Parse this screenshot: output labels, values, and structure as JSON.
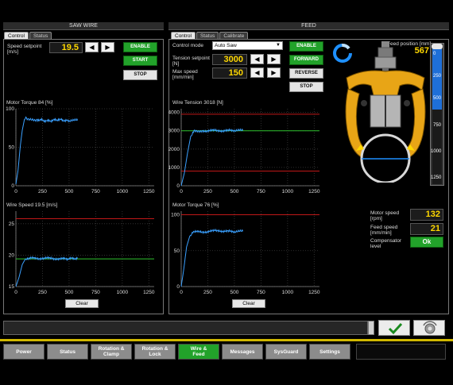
{
  "saw_wire": {
    "title": "SAW WIRE",
    "tabs": [
      "Control",
      "Status"
    ],
    "speed_setpoint": {
      "label": "Speed setpoint",
      "unit": "[m/s]",
      "value": "19.5"
    },
    "buttons": {
      "enable": "ENABLE",
      "start": "START",
      "stop": "STOP"
    },
    "chart_clear_label": "Clear"
  },
  "feed": {
    "title": "FEED",
    "tabs": [
      "Control",
      "Status",
      "Calibrate"
    ],
    "control_mode": {
      "label": "Control mode",
      "value": "Auto Saw"
    },
    "tension_setpoint": {
      "label": "Tension setpoint",
      "unit": "[N]",
      "value": "3000"
    },
    "max_speed": {
      "label": "Max speed",
      "unit": "[mm/min]",
      "value": "150"
    },
    "buttons": {
      "enable": "ENABLE",
      "forward": "FORWARD",
      "reverse": "REVERSE",
      "stop": "STOP"
    },
    "feed_position": {
      "label": "Feed position [mm]",
      "value": "567"
    },
    "gauge_ticks": [
      "0",
      "250",
      "500",
      "750",
      "1000",
      "1250"
    ],
    "motor_speed": {
      "label": "Motor speed",
      "unit": "[rpm]",
      "value": "132"
    },
    "feed_speed": {
      "label": "Feed speed",
      "unit": "[mm/min]",
      "value": "21"
    },
    "compensator": {
      "label": "Compensator",
      "label2": "level",
      "value": "Ok"
    },
    "chart_clear_label": "Clear"
  },
  "nav": [
    {
      "label": "Power",
      "active": false
    },
    {
      "label": "Status",
      "active": false
    },
    {
      "label": "Rotation &\nClamp",
      "active": false
    },
    {
      "label": "Rotation &\nLock",
      "active": false
    },
    {
      "label": "Wire &\nFeed",
      "active": true
    },
    {
      "label": "Messages",
      "active": false
    },
    {
      "label": "SysGuard",
      "active": false
    },
    {
      "label": "Settings",
      "active": false
    }
  ],
  "icons": {
    "confirm": "checkmark-icon",
    "reset": "reset-icon",
    "busy": "busy-spinner-icon"
  },
  "colors": {
    "accent_green": "#22a22a",
    "value_yellow": "#ffd800",
    "trace_blue": "#3aa0ff",
    "limit_red": "#c01818",
    "target_green": "#2fc42f",
    "machine_orange": "#e8a516"
  },
  "chart_data": [
    {
      "type": "line",
      "title": "Motor Torque 84 [%]",
      "xlim": [
        0,
        1300
      ],
      "ylim": [
        0,
        100
      ],
      "xticks": [
        0,
        250,
        500,
        750,
        1000,
        1250
      ],
      "yticks": [
        0,
        50,
        100
      ],
      "series": [
        {
          "points": [
            [
              0,
              2
            ],
            [
              20,
              20
            ],
            [
              40,
              50
            ],
            [
              60,
              72
            ],
            [
              80,
              86
            ],
            [
              100,
              88
            ],
            [
              150,
              85
            ],
            [
              200,
              86
            ],
            [
              300,
              84
            ],
            [
              400,
              86
            ],
            [
              500,
              84
            ],
            [
              580,
              85
            ]
          ]
        }
      ],
      "hlines": []
    },
    {
      "type": "line",
      "title": "Wire Speed 19.5 [m/s]",
      "xlim": [
        0,
        1300
      ],
      "ylim": [
        15,
        27
      ],
      "xticks": [
        0,
        250,
        500,
        750,
        1000,
        1250
      ],
      "yticks": [
        15,
        20,
        25
      ],
      "series": [
        {
          "points": [
            [
              0,
              15
            ],
            [
              30,
              16.5
            ],
            [
              60,
              18.5
            ],
            [
              90,
              19.4
            ],
            [
              150,
              19.5
            ],
            [
              300,
              19.5
            ],
            [
              450,
              19.4
            ],
            [
              580,
              19.5
            ]
          ]
        }
      ],
      "hlines": [
        {
          "y": 25.8,
          "color": "red"
        },
        {
          "y": 19.4,
          "color": "green"
        }
      ]
    },
    {
      "type": "line",
      "title": "Wire Tension 3018 [N]",
      "xlim": [
        0,
        1300
      ],
      "ylim": [
        0,
        4200
      ],
      "xticks": [
        0,
        250,
        500,
        750,
        1000,
        1250
      ],
      "yticks": [
        0,
        1000,
        2000,
        3000,
        4000
      ],
      "series": [
        {
          "points": [
            [
              0,
              0
            ],
            [
              30,
              700
            ],
            [
              60,
              1800
            ],
            [
              90,
              2700
            ],
            [
              120,
              3000
            ],
            [
              200,
              3000
            ],
            [
              350,
              3010
            ],
            [
              500,
              3000
            ],
            [
              580,
              3010
            ]
          ]
        }
      ],
      "hlines": [
        {
          "y": 3900,
          "color": "red"
        },
        {
          "y": 3000,
          "color": "green"
        },
        {
          "y": 800,
          "color": "red"
        }
      ]
    },
    {
      "type": "line",
      "title": "Motor Torque 76 [%]",
      "xlim": [
        0,
        1300
      ],
      "ylim": [
        0,
        105
      ],
      "xticks": [
        0,
        250,
        500,
        750,
        1000,
        1250
      ],
      "yticks": [
        0,
        50,
        100
      ],
      "series": [
        {
          "points": [
            [
              0,
              0
            ],
            [
              25,
              25
            ],
            [
              50,
              55
            ],
            [
              80,
              70
            ],
            [
              110,
              76
            ],
            [
              200,
              76
            ],
            [
              350,
              78
            ],
            [
              500,
              76
            ],
            [
              580,
              77
            ]
          ]
        }
      ],
      "hlines": [
        {
          "y": 100,
          "color": "red"
        }
      ]
    }
  ]
}
